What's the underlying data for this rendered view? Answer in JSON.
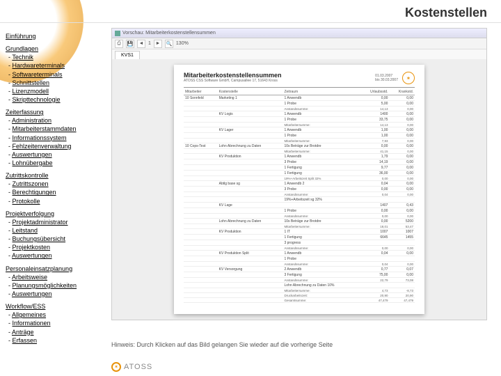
{
  "header": "Kostenstellen",
  "nav": {
    "intro": "Einführung",
    "sections": [
      {
        "head": "Grundlagen",
        "items": [
          "Technik",
          "Hardwareterminals",
          "Softwareterminals",
          "Schnittstellen",
          "Lizenzmodell",
          "Skripttechnologie"
        ]
      },
      {
        "head": "Zeiterfassung",
        "items": [
          "Administration",
          "Mitarbeiterstammdaten",
          "Informationssystem",
          "Fehlzeitenverwaltung",
          "Auswertungen",
          "Lohnübergabe"
        ]
      },
      {
        "head": "Zutrittskontrolle",
        "items": [
          "Zutrittszonen",
          "Berechtigungen",
          "Protokolle"
        ]
      },
      {
        "head": "Projektverfolgung",
        "items": [
          "Projektadministrator",
          "Leitstand",
          "Buchungsübersicht",
          "Projektkosten",
          "Auswertungen"
        ]
      },
      {
        "head": "Personaleinsatzplanung",
        "items": [
          "Arbeitsweise",
          "Planungsmöglichkeiten",
          "Auswertungen"
        ]
      },
      {
        "head": "Workflow/ESS",
        "items": [
          "Allgemeines",
          "Informationen",
          "Anträge",
          "Erfassen"
        ]
      }
    ]
  },
  "preview": {
    "window_title": "Vorschau: Mitarbeiterkostenstellensummen",
    "tab": "KVS1",
    "toolbar_page": "1",
    "toolbar_zoom": "130%",
    "report": {
      "title": "Mitarbeiterkostenstellensummen",
      "subtitle": "ATOSS CSS Software GmbH, Campusallee 17, 51643 Kross",
      "meta": {
        "left": "01.03.2007",
        "right_label": "bis",
        "right": "30.03.2007"
      },
      "cols": [
        "Mitarbeiter",
        "Kostenstelle",
        "Zeitraum",
        "Urlaubsstd.",
        "Krankstd."
      ],
      "rows": [
        {
          "g": 1,
          "c": [
            "10 Sonnfeld",
            "Marketing 1",
            "1 Anwendb",
            "0,00",
            "0,00"
          ]
        },
        {
          "c": [
            "",
            "",
            "1 Probe",
            "5,00",
            "0,00"
          ]
        },
        {
          "s": 1,
          "c": [
            "",
            "",
            "Anstandssumme:",
            "14,13",
            "0,00"
          ]
        },
        {
          "g": 1,
          "c": [
            "",
            "KV Logis",
            "1 Anwendb",
            "1400",
            "0,00"
          ]
        },
        {
          "c": [
            "",
            "",
            "1 Probe",
            "33,75",
            "0,00"
          ]
        },
        {
          "s": 1,
          "c": [
            "",
            "",
            "Mitarbeitersumme:",
            "14,13",
            "0,00"
          ]
        },
        {
          "g": 1,
          "c": [
            "",
            "KV Lager",
            "1 Anwendb",
            "1,00",
            "0,00"
          ]
        },
        {
          "c": [
            "",
            "",
            "1 Probe",
            "1,00",
            "0,00"
          ]
        },
        {
          "s": 1,
          "c": [
            "",
            "",
            "Mitarbeitersumme:",
            "7,93",
            "0,00"
          ]
        },
        {
          "g": 1,
          "c": [
            "10 Cops-Test",
            "Lohn Abrechnung zu Daten",
            "10s Beträge zur Brotdre",
            "0,00",
            "0,00"
          ]
        },
        {
          "s": 1,
          "c": [
            "",
            "",
            "Mitarbeitersumme:",
            "41,15",
            "0,00"
          ]
        },
        {
          "g": 1,
          "c": [
            "",
            "KV Produktion",
            "1 Anwendb",
            "1,79",
            "0,00"
          ]
        },
        {
          "c": [
            "",
            "",
            "3 Probe",
            "14,19",
            "0,00"
          ]
        },
        {
          "c": [
            "",
            "",
            "1 Fertigung",
            "9,77",
            "0,00"
          ]
        },
        {
          "c": [
            "",
            "",
            "1 Fertigung",
            "36,00",
            "0,00"
          ]
        },
        {
          "s": 1,
          "c": [
            "",
            "",
            "19%+Arbeitszeit Split 32%",
            "0,00",
            "0,00"
          ]
        },
        {
          "g": 1,
          "c": [
            "",
            "Abtlg base sg",
            "1 Anwendb 2",
            "0,04",
            "0,00"
          ]
        },
        {
          "c": [
            "",
            "",
            "3 Probe",
            "0,00",
            "0,00"
          ]
        },
        {
          "s": 1,
          "c": [
            "",
            "",
            "Anstandssumme:",
            "0,04",
            "0,00"
          ]
        },
        {
          "g": 1,
          "c": [
            "",
            "",
            "19%+Arbeitszeit sg 32%",
            "",
            ""
          ]
        },
        {
          "g": 1,
          "c": [
            "",
            "KV Lage",
            "",
            "1407",
            "0,43"
          ]
        },
        {
          "c": [
            "",
            "",
            "1 Probe",
            "0,00",
            "0,00"
          ]
        },
        {
          "s": 1,
          "c": [
            "",
            "",
            "Anstandssumme:",
            "0,00",
            "0,00"
          ]
        },
        {
          "g": 1,
          "c": [
            "",
            "Lohn Abrechnung zu Daten",
            "10s Beträge zur Brotdre",
            "0,00",
            "5200"
          ]
        },
        {
          "s": 1,
          "c": [
            "",
            "",
            "Mitarbeitersumme:",
            "18,01",
            "53,47"
          ]
        },
        {
          "g": 1,
          "c": [
            "",
            "KV Produktion",
            "1 IT",
            "1007",
            "1007"
          ]
        },
        {
          "c": [
            "",
            "",
            "1 Fertigung",
            "6645",
            "1455"
          ]
        },
        {
          "c": [
            "",
            "",
            "3 progress",
            "",
            ""
          ]
        },
        {
          "s": 1,
          "c": [
            "",
            "",
            "Anstandssumme:",
            "0,00",
            "0,00"
          ]
        },
        {
          "g": 1,
          "c": [
            "",
            "KV Produktion Split",
            "1 Anwendb",
            "0,04",
            "0,00"
          ]
        },
        {
          "c": [
            "",
            "",
            "1 Probe",
            "",
            ""
          ]
        },
        {
          "s": 1,
          "c": [
            "",
            "",
            "Anstandssumme:",
            "0,04",
            "0,00"
          ]
        },
        {
          "g": 1,
          "c": [
            "",
            "KV Versorgung",
            "2 Anwendb",
            "0,77",
            "0,07"
          ]
        },
        {
          "c": [
            "",
            "",
            "3 Fertigung",
            "75,00",
            "0,00"
          ]
        },
        {
          "s": 1,
          "c": [
            "",
            "",
            "Anstandssumme:",
            "22,79",
            "73,08"
          ]
        },
        {
          "g": 1,
          "c": [
            "",
            "",
            "Lohn Abrechnung zu Daten 10%",
            "",
            ""
          ]
        },
        {
          "s": 1,
          "c": [
            "",
            "",
            "Mitarbeitersumme:",
            "4,73",
            "-8,73"
          ]
        },
        {
          "s": 1,
          "c": [
            "",
            "",
            "Druckarbeitszeit:",
            "20,90",
            "20,90"
          ]
        },
        {
          "s": 1,
          "c": [
            "",
            "",
            "Gesamtsumme:",
            "47,479",
            "47,479"
          ]
        }
      ]
    }
  },
  "hint": "Hinweis: Durch Klicken auf das Bild gelangen Sie wieder auf die vorherige Seite",
  "footer": "ATOSS"
}
